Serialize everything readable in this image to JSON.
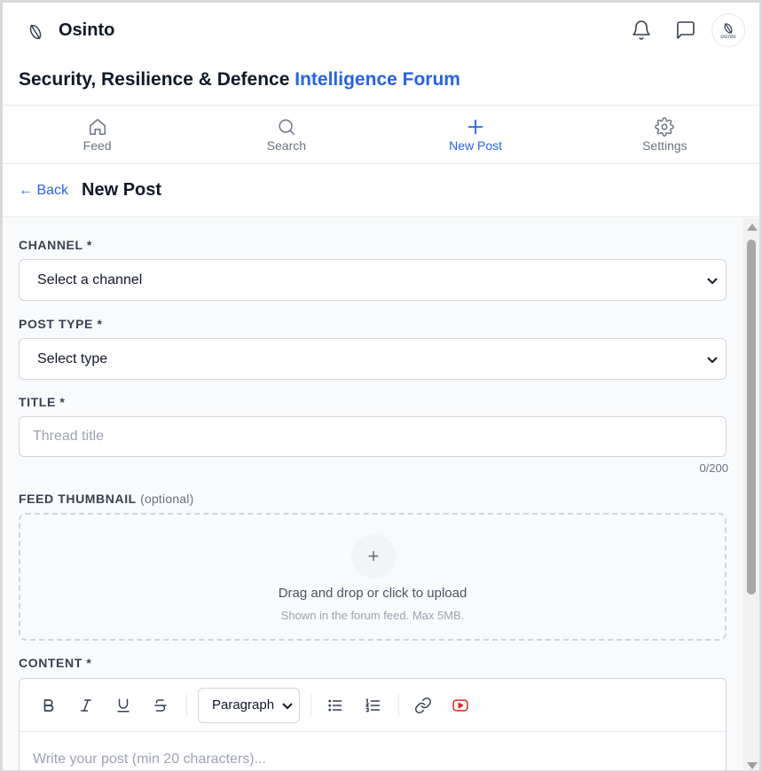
{
  "app": {
    "name": "Osinto",
    "avatar_text": "osinto"
  },
  "forum": {
    "title_main": "Security, Resilience & Defence",
    "title_accent": "Intelligence Forum"
  },
  "colors": {
    "accent": "#2563eb",
    "border": "#d1d5db",
    "youtube": "#dc2626"
  },
  "nav": {
    "items": [
      {
        "label": "Feed",
        "icon": "home-icon"
      },
      {
        "label": "Search",
        "icon": "search-icon"
      },
      {
        "label": "New Post",
        "icon": "plus-icon",
        "active": true
      },
      {
        "label": "Settings",
        "icon": "gear-icon"
      }
    ]
  },
  "page": {
    "back_label": "← Back",
    "title": "New Post"
  },
  "form": {
    "channel": {
      "label": "CHANNEL *",
      "value": "Select a channel"
    },
    "post_type": {
      "label": "POST TYPE *",
      "value": "Select type"
    },
    "title": {
      "label": "TITLE *",
      "placeholder": "Thread title",
      "counter": "0/200"
    },
    "thumbnail": {
      "label": "FEED THUMBNAIL",
      "optional": "(optional)",
      "plus": "+",
      "main_text": "Drag and drop or click to upload",
      "sub_text": "Shown in the forum feed. Max 5MB."
    },
    "content": {
      "label": "CONTENT *",
      "paragraph_value": "Paragraph",
      "placeholder": "Write your post (min 20 characters)..."
    }
  }
}
